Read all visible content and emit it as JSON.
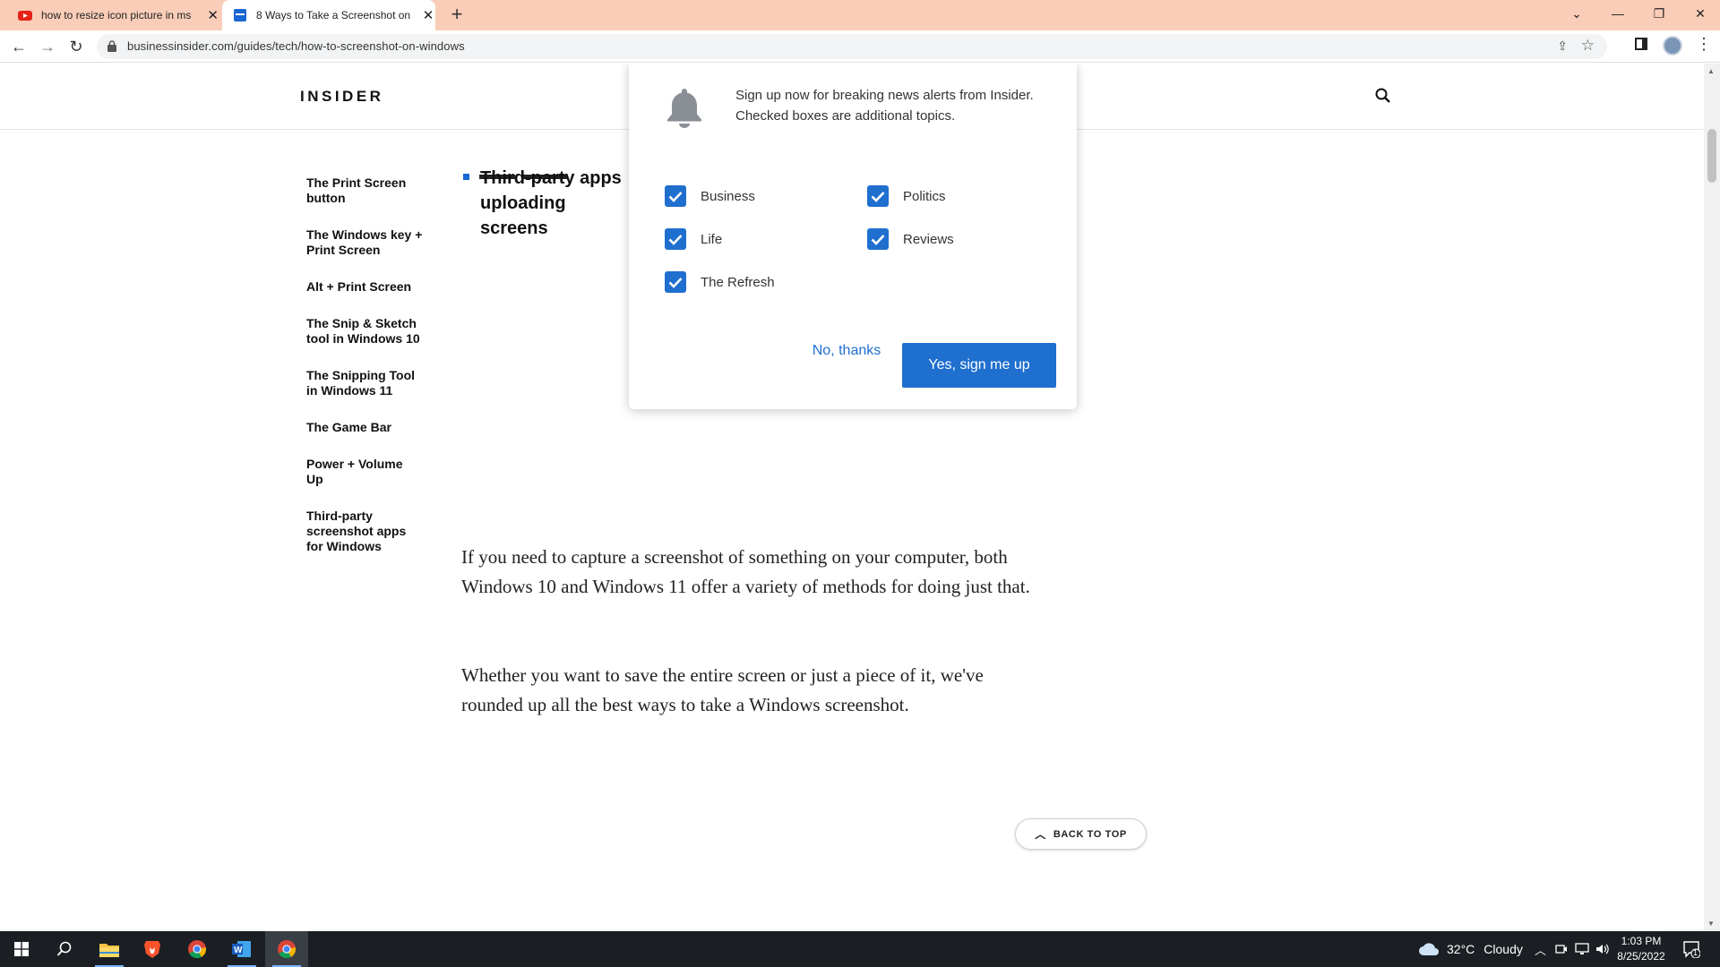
{
  "browser": {
    "tabs": [
      {
        "title": "how to resize icon picture in ms",
        "favicon": "youtube-icon",
        "active": false
      },
      {
        "title": "8 Ways to Take a Screenshot on",
        "favicon": "insider-icon",
        "active": true
      }
    ],
    "new_tab": "+",
    "url": "businessinsider.com/guides/tech/how-to-screenshot-on-windows"
  },
  "site": {
    "logo": "INSIDER"
  },
  "toc": {
    "items": [
      "The Print Screen button",
      "The Windows key + Print Screen",
      "Alt + Print Screen",
      "The Snip & Sketch tool in Windows 10",
      "The Snipping Tool in Windows 11",
      "The Game Bar",
      "Power + Volume Up",
      "Third-party screenshot apps for Windows"
    ]
  },
  "article": {
    "bullet_text": "Third-party apps uploading screens",
    "paragraphs": [
      "If you need to capture a screenshot of something on your computer, both Windows 10 and Windows 11 offer a variety of methods for doing just that.",
      "Whether you want to save the entire screen or just a piece of it, we've rounded up all the best ways to take a Windows screenshot."
    ],
    "back_to_top": "BACK TO TOP"
  },
  "popup": {
    "message": "Sign up now for breaking news alerts from Insider. Checked boxes are additional topics.",
    "topics": [
      {
        "label": "Business",
        "checked": true
      },
      {
        "label": "Politics",
        "checked": true
      },
      {
        "label": "Life",
        "checked": true
      },
      {
        "label": "Reviews",
        "checked": true
      },
      {
        "label": "The Refresh",
        "checked": true
      }
    ],
    "decline": "No, thanks",
    "accept": "Yes, sign me up",
    "accent": "#1f6fcf"
  },
  "taskbar": {
    "weather": {
      "temp": "32°C",
      "condition": "Cloudy"
    },
    "time": "1:03 PM",
    "date": "8/25/2022",
    "notification_count": "1"
  }
}
